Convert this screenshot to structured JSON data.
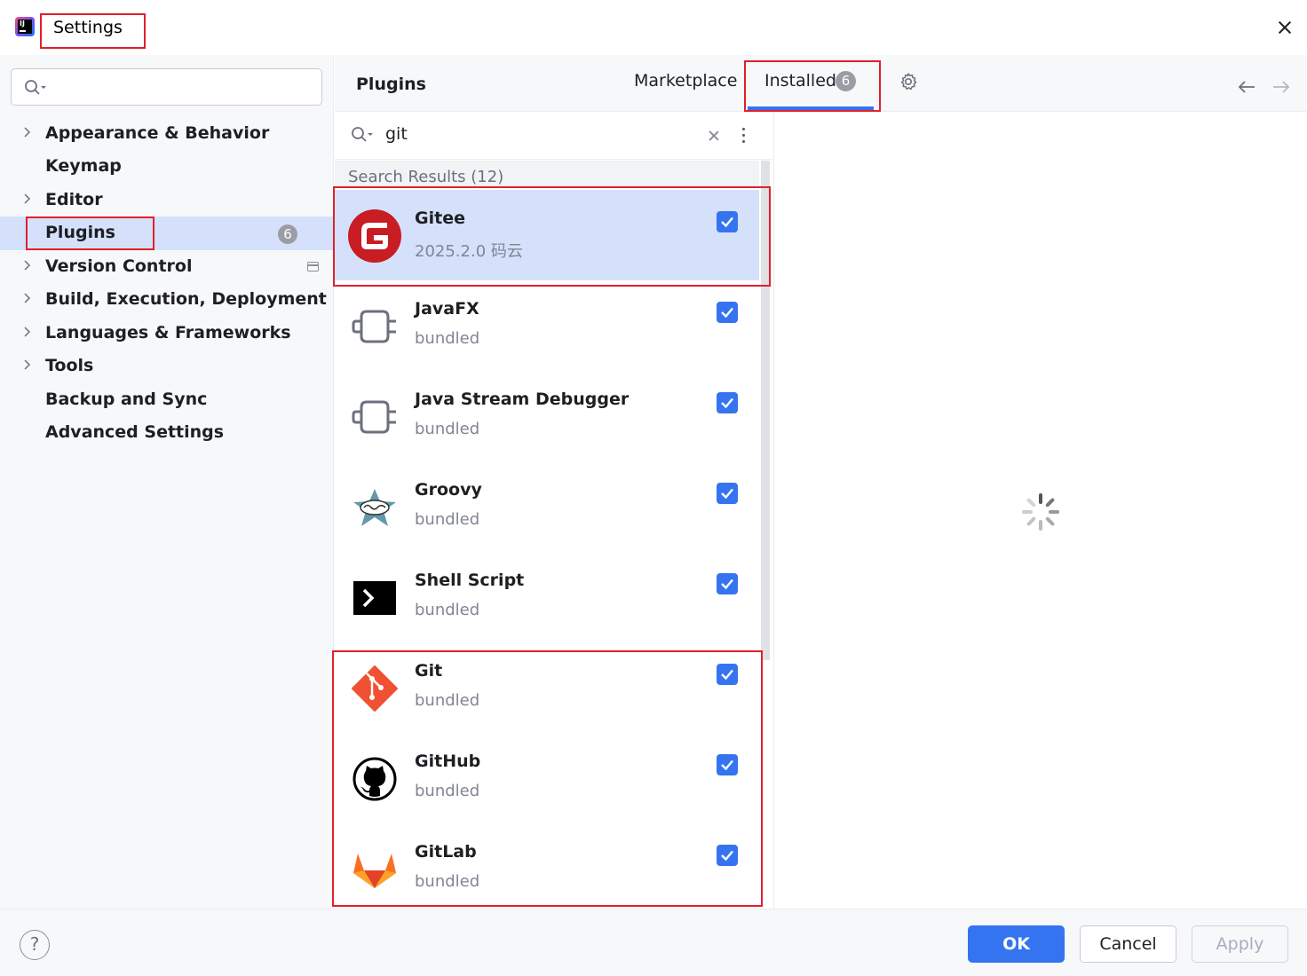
{
  "window": {
    "title": "Settings",
    "app_icon": "intellij-idea-icon"
  },
  "sidebar": {
    "search": {
      "value": "",
      "placeholder": ""
    },
    "items": [
      {
        "label": "Appearance & Behavior",
        "expandable": true
      },
      {
        "label": "Keymap",
        "expandable": false
      },
      {
        "label": "Editor",
        "expandable": true
      },
      {
        "label": "Plugins",
        "expandable": false,
        "selected": true,
        "badge": "6"
      },
      {
        "label": "Version Control",
        "expandable": true,
        "project_icon": "project-settings-icon"
      },
      {
        "label": "Build, Execution, Deployment",
        "expandable": true
      },
      {
        "label": "Languages & Frameworks",
        "expandable": true
      },
      {
        "label": "Tools",
        "expandable": true
      },
      {
        "label": "Backup and Sync",
        "expandable": false
      },
      {
        "label": "Advanced Settings",
        "expandable": false
      }
    ]
  },
  "plugins": {
    "title": "Plugins",
    "tabs": [
      {
        "label": "Marketplace"
      },
      {
        "label": "Installed",
        "badge": "6",
        "active": true
      }
    ],
    "search_value": "git",
    "results_header": "Search Results (12)",
    "items": [
      {
        "name": "Gitee",
        "subtitle": "2025.2.0  码云",
        "enabled": true,
        "selected": true,
        "icon": "gitee-icon"
      },
      {
        "name": "JavaFX",
        "subtitle": "bundled",
        "enabled": true,
        "icon": "plugin-plug-icon"
      },
      {
        "name": "Java Stream Debugger",
        "subtitle": "bundled",
        "enabled": true,
        "icon": "plugin-plug-icon"
      },
      {
        "name": "Groovy",
        "subtitle": "bundled",
        "enabled": true,
        "icon": "groovy-star-icon"
      },
      {
        "name": "Shell Script",
        "subtitle": "bundled",
        "enabled": true,
        "icon": "terminal-icon"
      },
      {
        "name": "Git",
        "subtitle": "bundled",
        "enabled": true,
        "icon": "git-icon"
      },
      {
        "name": "GitHub",
        "subtitle": "bundled",
        "enabled": true,
        "icon": "github-octocat-icon"
      },
      {
        "name": "GitLab",
        "subtitle": "bundled",
        "enabled": true,
        "icon": "gitlab-fox-icon"
      }
    ]
  },
  "footer": {
    "help_symbol": "?",
    "ok_label": "OK",
    "cancel_label": "Cancel",
    "apply_label": "Apply"
  },
  "colors": {
    "accent": "#3574f0",
    "selection": "#d5e1fb",
    "highlight_box": "#e0202b"
  }
}
